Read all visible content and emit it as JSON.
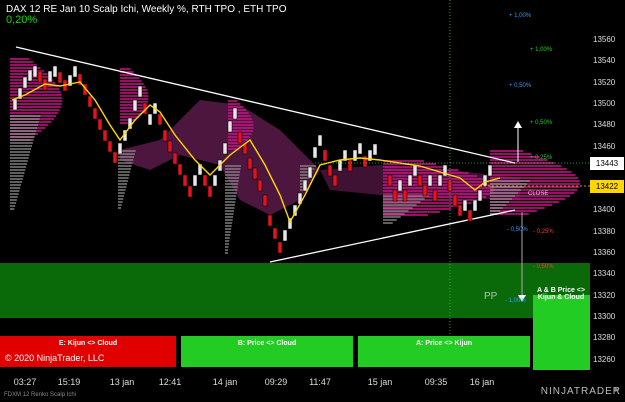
{
  "header": {
    "title": "DAX 12 RE Jan 10 Scalp Ichi, Weekly %, RTH TPO , ETH TPO",
    "change_pct": "0,20%"
  },
  "y_axis": {
    "ticks": [
      "13560",
      "13540",
      "13520",
      "13500",
      "13480",
      "13460",
      "13440",
      "13420",
      "13400",
      "13380",
      "13360",
      "13340",
      "13320",
      "13300",
      "13280",
      "13260"
    ],
    "price_badges": {
      "upper": "13443",
      "current": "13422"
    }
  },
  "x_axis": {
    "ticks": [
      "03:27",
      "15:19",
      "13 jan",
      "12:41",
      "14 jan",
      "09:29",
      "11:47",
      "15 jan",
      "09:35",
      "16 jan"
    ]
  },
  "levels": {
    "blue": [
      "+ 1,00%",
      "+ 0,50%"
    ],
    "green": [
      "+ 1,00%",
      "+ 0,50%",
      "+ 0,25%"
    ],
    "white": [
      "+ 0,50%",
      "+ 0,25%"
    ],
    "red": [
      "- 0,25%",
      "- 0,50%"
    ],
    "neg_blue": [
      "- 0,50%",
      "- 1,00%"
    ],
    "close": "CLOSE"
  },
  "zones": {
    "e": "E: Kijun <> Cloud",
    "b": "B: Price <> Cloud",
    "a": "A: Price <> Kijun",
    "ab": "A & B Price <> Kijun & Cloud"
  },
  "copyright": "© 2020 NinjaTrader, LLC",
  "pp_label": "PP",
  "footer": {
    "instrument": "FDXM 12 Renko Scalp Ichi",
    "brand": "NINJATRADER"
  },
  "colors": {
    "background": "#000000",
    "bull_brick": "#e8e8e8",
    "bear_brick": "#e8121b",
    "kijun": "#ffd700",
    "cloud": "#5a1a4a",
    "tpo_profile": "#c0137f",
    "green_zone": "#0a6a0a",
    "red_zone": "#e00000",
    "bright_green": "#22cc22"
  }
}
